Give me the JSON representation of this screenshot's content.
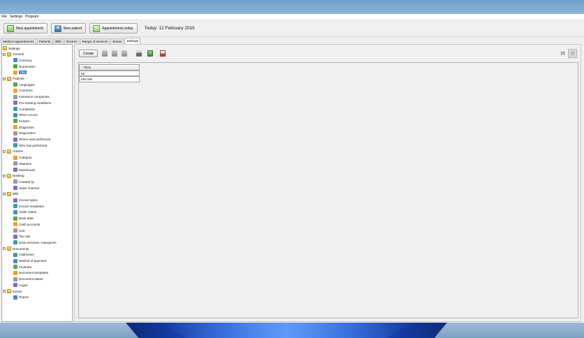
{
  "menu": {
    "items": [
      "File",
      "Settings",
      "Program"
    ]
  },
  "toolbar": {
    "new_appointment": "New appointment",
    "new_patient": "New patient",
    "appointments_today": "Appointments today",
    "today_label": "Today: 12 February 2015"
  },
  "tabs": [
    "Medical appointments",
    "Patients",
    "Bills",
    "Doctors",
    "Range of services",
    "Extras",
    "Settings"
  ],
  "active_tab": "Settings",
  "tree": {
    "root": "Settings",
    "groups": [
      {
        "label": "General",
        "items": [
          "Currency",
          "Numeration",
          "Title"
        ]
      },
      {
        "label": "Patients",
        "items": [
          "Languages",
          "Countries",
          "Insurance companies",
          "Pre-existing conditions",
          "Complaints",
          "When occurs",
          "Incitant",
          "Diagnoses",
          "Diagnostics",
          "Where was performed",
          "Who has performed"
        ]
      },
      {
        "label": "Articles",
        "items": [
          "Category",
          "Statuses",
          "Warehouse"
        ]
      },
      {
        "label": "Booking",
        "items": [
          "Created by",
          "Sales channel"
        ]
      },
      {
        "label": "Bills",
        "items": [
          "Invoice types",
          "Invoice templates",
          "Order status",
          "Bank data",
          "Cash accounts",
          "Unit",
          "Tax rate",
          "Extra services: Categories"
        ]
      },
      {
        "label": "Documents",
        "items": [
          "Addresses",
          "Method of payment",
          "Footnote",
          "Document templates",
          "Document status",
          "Logos"
        ]
      },
      {
        "label": "Extras",
        "items": [
          "Report"
        ]
      }
    ],
    "selected": "Title"
  },
  "content": {
    "create_label": "Create",
    "count": "[2]",
    "table": {
      "header": "↑ Titles",
      "rows": [
        "Mr",
        "Mrs./Ms"
      ]
    }
  }
}
